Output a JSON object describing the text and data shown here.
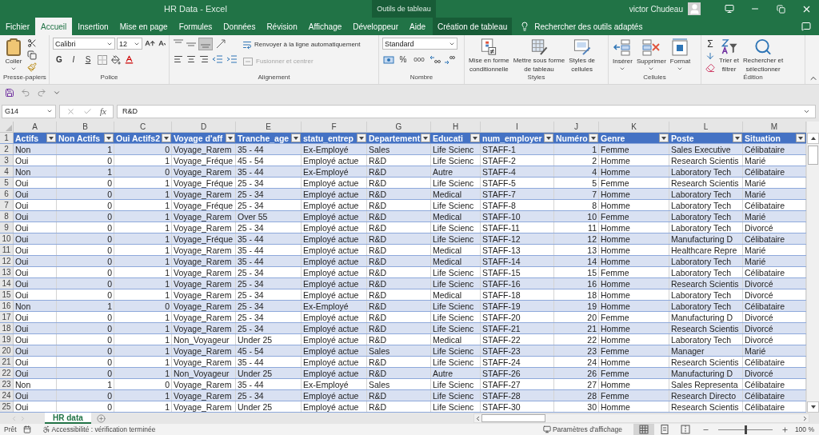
{
  "window": {
    "title": "HR Data  -  Excel",
    "context_label": "Outils de tableau",
    "user": "victor Chudeau"
  },
  "tabs": [
    {
      "label": "Fichier",
      "selected": false,
      "kind": "normal"
    },
    {
      "label": "Accueil",
      "selected": true,
      "kind": "normal"
    },
    {
      "label": "Insertion",
      "selected": false,
      "kind": "normal"
    },
    {
      "label": "Mise en page",
      "selected": false,
      "kind": "normal"
    },
    {
      "label": "Formules",
      "selected": false,
      "kind": "normal"
    },
    {
      "label": "Données",
      "selected": false,
      "kind": "normal"
    },
    {
      "label": "Révision",
      "selected": false,
      "kind": "normal"
    },
    {
      "label": "Affichage",
      "selected": false,
      "kind": "normal"
    },
    {
      "label": "Développeur",
      "selected": false,
      "kind": "normal"
    },
    {
      "label": "Aide",
      "selected": false,
      "kind": "normal"
    },
    {
      "label": "Création de tableau",
      "selected": false,
      "kind": "context"
    }
  ],
  "search_hint": "Rechercher des outils adaptés",
  "ribbon": {
    "clipboard": {
      "label": "Presse-papiers",
      "paste": "Coller"
    },
    "font": {
      "label": "Police",
      "font": "Calibri",
      "size": "12",
      "bold": "G",
      "italic": "I",
      "underline": "S"
    },
    "alignment": {
      "label": "Alignement",
      "wrap": "Renvoyer à la ligne automatiquement",
      "merge": {
        "label": "Fusionner et centrer",
        "disabled": true
      }
    },
    "number": {
      "label": "Nombre",
      "format": "Standard",
      "percent": "%",
      "thousands": "000"
    },
    "styles": {
      "label": "Styles",
      "buttons": [
        {
          "lines": [
            "Mise en forme",
            "conditionnelle"
          ],
          "kind": "conditional"
        },
        {
          "lines": [
            "Mettre sous forme",
            "de tableau"
          ],
          "kind": "table"
        },
        {
          "lines": [
            "Styles de",
            "cellules"
          ],
          "kind": "cellstyle"
        }
      ]
    },
    "cells": {
      "label": "Cellules",
      "buttons": [
        {
          "label": "Insérer",
          "kind": "insert"
        },
        {
          "label": "Supprimer",
          "kind": "delete"
        },
        {
          "label": "Format",
          "kind": "format"
        }
      ]
    },
    "editing": {
      "label": "Édition",
      "sum": "Σ",
      "buttons": [
        {
          "lines": [
            "Trier et",
            "filtrer"
          ],
          "kind": "sort"
        },
        {
          "lines": [
            "Rechercher et",
            "sélectionner"
          ],
          "kind": "find"
        }
      ]
    }
  },
  "formula_bar": {
    "name_box": "G14",
    "fx": "fx",
    "value": "R&D"
  },
  "table": {
    "header_row_number": "1",
    "columns": [
      {
        "letter": "A",
        "header": "Actifs",
        "kind": "text"
      },
      {
        "letter": "B",
        "header": "Non Actifs",
        "kind": "number"
      },
      {
        "letter": "C",
        "header": "Oui Actifs2",
        "kind": "number"
      },
      {
        "letter": "D",
        "header": "Voyage d'aff",
        "kind": "text"
      },
      {
        "letter": "E",
        "header": "Tranche_age",
        "kind": "text"
      },
      {
        "letter": "F",
        "header": "statu_entrep",
        "kind": "text"
      },
      {
        "letter": "G",
        "header": "Departement",
        "kind": "text"
      },
      {
        "letter": "H",
        "header": "Educati",
        "kind": "text"
      },
      {
        "letter": "I",
        "header": "num_employer",
        "kind": "text"
      },
      {
        "letter": "J",
        "header": "Numéro",
        "kind": "number"
      },
      {
        "letter": "K",
        "header": "Genre",
        "kind": "text"
      },
      {
        "letter": "L",
        "header": "Poste",
        "kind": "text"
      },
      {
        "letter": "M",
        "header": "Situation",
        "kind": "text"
      }
    ],
    "rows": [
      {
        "number": "2",
        "cells": [
          "Non",
          "1",
          "0",
          "Voyage_Rarem",
          "35 - 44",
          "Ex-Employé",
          "Sales",
          "Life Scienc",
          "STAFF-1",
          "1",
          "Femme",
          "Sales Executive",
          "Célibataire"
        ]
      },
      {
        "number": "3",
        "cells": [
          "Oui",
          "0",
          "1",
          "Voyage_Fréque",
          "45 - 54",
          "Employé actue",
          "R&D",
          "Life Scienc",
          "STAFF-2",
          "2",
          "Homme",
          "Research Scientis",
          "Marié"
        ]
      },
      {
        "number": "4",
        "cells": [
          "Non",
          "1",
          "0",
          "Voyage_Rarem",
          "35 - 44",
          "Ex-Employé",
          "R&D",
          "Autre",
          "STAFF-4",
          "4",
          "Homme",
          "Laboratory Tech",
          "Célibataire"
        ]
      },
      {
        "number": "5",
        "cells": [
          "Oui",
          "0",
          "1",
          "Voyage_Fréque",
          "25 - 34",
          "Employé actue",
          "R&D",
          "Life Scienc",
          "STAFF-5",
          "5",
          "Femme",
          "Research Scientis",
          "Marié"
        ]
      },
      {
        "number": "6",
        "cells": [
          "Oui",
          "0",
          "1",
          "Voyage_Rarem",
          "25 - 34",
          "Employé actue",
          "R&D",
          "Medical",
          "STAFF-7",
          "7",
          "Homme",
          "Laboratory Tech",
          "Marié"
        ]
      },
      {
        "number": "7",
        "cells": [
          "Oui",
          "0",
          "1",
          "Voyage_Fréque",
          "25 - 34",
          "Employé actue",
          "R&D",
          "Life Scienc",
          "STAFF-8",
          "8",
          "Homme",
          "Laboratory Tech",
          "Célibataire"
        ]
      },
      {
        "number": "8",
        "cells": [
          "Oui",
          "0",
          "1",
          "Voyage_Rarem",
          "Over 55",
          "Employé actue",
          "R&D",
          "Medical",
          "STAFF-10",
          "10",
          "Femme",
          "Laboratory Tech",
          "Marié"
        ]
      },
      {
        "number": "9",
        "cells": [
          "Oui",
          "0",
          "1",
          "Voyage_Rarem",
          "25 - 34",
          "Employé actue",
          "R&D",
          "Life Scienc",
          "STAFF-11",
          "11",
          "Homme",
          "Laboratory Tech",
          "Divorcé"
        ]
      },
      {
        "number": "10",
        "cells": [
          "Oui",
          "0",
          "1",
          "Voyage_Fréque",
          "35 - 44",
          "Employé actue",
          "R&D",
          "Life Scienc",
          "STAFF-12",
          "12",
          "Homme",
          "Manufacturing D",
          "Célibataire"
        ]
      },
      {
        "number": "11",
        "cells": [
          "Oui",
          "0",
          "1",
          "Voyage_Rarem",
          "35 - 44",
          "Employé actue",
          "R&D",
          "Medical",
          "STAFF-13",
          "13",
          "Homme",
          "Healthcare Repre",
          "Marié"
        ]
      },
      {
        "number": "12",
        "cells": [
          "Oui",
          "0",
          "1",
          "Voyage_Rarem",
          "35 - 44",
          "Employé actue",
          "R&D",
          "Medical",
          "STAFF-14",
          "14",
          "Homme",
          "Laboratory Tech",
          "Marié"
        ]
      },
      {
        "number": "13",
        "cells": [
          "Oui",
          "0",
          "1",
          "Voyage_Rarem",
          "25 - 34",
          "Employé actue",
          "R&D",
          "Life Scienc",
          "STAFF-15",
          "15",
          "Femme",
          "Laboratory Tech",
          "Célibataire"
        ]
      },
      {
        "number": "14",
        "cells": [
          "Oui",
          "0",
          "1",
          "Voyage_Rarem",
          "25 - 34",
          "Employé actue",
          "R&D",
          "Life Scienc",
          "STAFF-16",
          "16",
          "Homme",
          "Research Scientis",
          "Divorcé"
        ]
      },
      {
        "number": "15",
        "cells": [
          "Oui",
          "0",
          "1",
          "Voyage_Rarem",
          "25 - 34",
          "Employé actue",
          "R&D",
          "Medical",
          "STAFF-18",
          "18",
          "Homme",
          "Laboratory Tech",
          "Divorcé"
        ]
      },
      {
        "number": "16",
        "cells": [
          "Non",
          "1",
          "0",
          "Voyage_Rarem",
          "25 - 34",
          "Ex-Employé",
          "R&D",
          "Life Scienc",
          "STAFF-19",
          "19",
          "Homme",
          "Laboratory Tech",
          "Célibataire"
        ]
      },
      {
        "number": "17",
        "cells": [
          "Oui",
          "0",
          "1",
          "Voyage_Rarem",
          "25 - 34",
          "Employé actue",
          "R&D",
          "Life Scienc",
          "STAFF-20",
          "20",
          "Femme",
          "Manufacturing D",
          "Divorcé"
        ]
      },
      {
        "number": "18",
        "cells": [
          "Oui",
          "0",
          "1",
          "Voyage_Rarem",
          "25 - 34",
          "Employé actue",
          "R&D",
          "Life Scienc",
          "STAFF-21",
          "21",
          "Homme",
          "Research Scientis",
          "Divorcé"
        ]
      },
      {
        "number": "19",
        "cells": [
          "Oui",
          "0",
          "1",
          "Non_Voyageur",
          "Under 25",
          "Employé actue",
          "R&D",
          "Medical",
          "STAFF-22",
          "22",
          "Homme",
          "Laboratory Tech",
          "Divorcé"
        ]
      },
      {
        "number": "20",
        "cells": [
          "Oui",
          "0",
          "1",
          "Voyage_Rarem",
          "45 - 54",
          "Employé actue",
          "Sales",
          "Life Scienc",
          "STAFF-23",
          "23",
          "Femme",
          "Manager",
          "Marié"
        ]
      },
      {
        "number": "21",
        "cells": [
          "Oui",
          "0",
          "1",
          "Voyage_Rarem",
          "35 - 44",
          "Employé actue",
          "R&D",
          "Life Scienc",
          "STAFF-24",
          "24",
          "Homme",
          "Research Scientis",
          "Célibataire"
        ]
      },
      {
        "number": "22",
        "cells": [
          "Oui",
          "0",
          "1",
          "Non_Voyageur",
          "Under 25",
          "Employé actue",
          "R&D",
          "Autre",
          "STAFF-26",
          "26",
          "Femme",
          "Manufacturing D",
          "Divorcé"
        ]
      },
      {
        "number": "23",
        "cells": [
          "Non",
          "1",
          "0",
          "Voyage_Rarem",
          "35 - 44",
          "Ex-Employé",
          "Sales",
          "Life Scienc",
          "STAFF-27",
          "27",
          "Homme",
          "Sales Representa",
          "Célibataire"
        ]
      },
      {
        "number": "24",
        "cells": [
          "Oui",
          "0",
          "1",
          "Voyage_Rarem",
          "25 - 34",
          "Employé actue",
          "R&D",
          "Life Scienc",
          "STAFF-28",
          "28",
          "Femme",
          "Research Directo",
          "Célibataire"
        ]
      },
      {
        "number": "25",
        "cells": [
          "Oui",
          "0",
          "1",
          "Voyage_Rarem",
          "Under 25",
          "Employé actue",
          "R&D",
          "Life Scienc",
          "STAFF-30",
          "30",
          "Homme",
          "Research Scientis",
          "Célibataire"
        ]
      }
    ]
  },
  "sheets": [
    {
      "label": "HR data",
      "selected": true
    }
  ],
  "status_bar": {
    "ready": "Prêt",
    "accessibility": "Accessibilité : vérification terminée",
    "display_settings": "Paramètres d'affichage",
    "views": [
      {
        "kind": "normal",
        "selected": true
      },
      {
        "kind": "layout",
        "selected": false
      },
      {
        "kind": "pagebreak",
        "selected": false
      }
    ],
    "zoom": {
      "level": 0.5,
      "reading": "100 %"
    }
  }
}
